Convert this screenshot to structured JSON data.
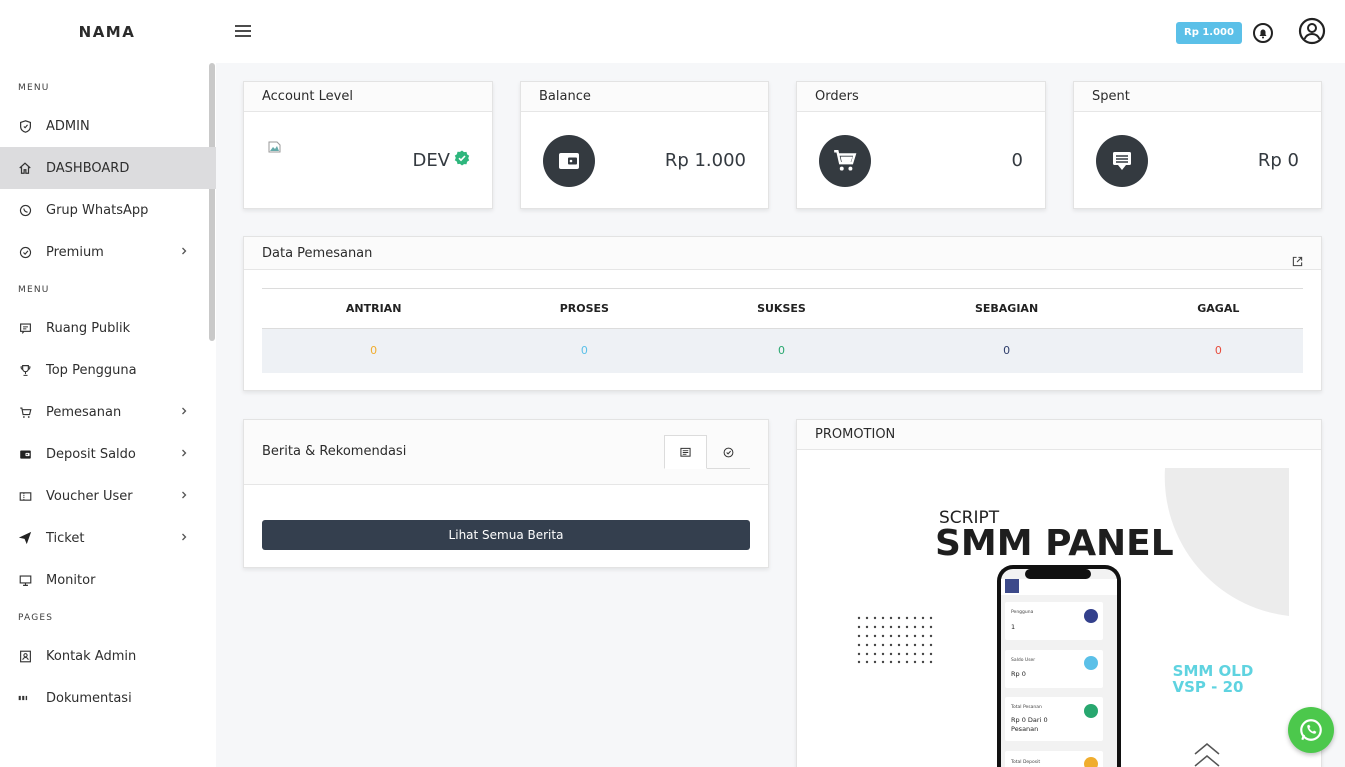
{
  "brand": "NAMA",
  "sidebar": {
    "sections": [
      {
        "title": "MENU",
        "items": [
          {
            "label": "ADMIN",
            "icon": "shield-icon"
          },
          {
            "label": "DASHBOARD",
            "icon": "home-icon",
            "active": true
          },
          {
            "label": "Grup WhatsApp",
            "icon": "whatsapp-icon"
          },
          {
            "label": "Premium",
            "icon": "check-circle-icon",
            "chevron": true
          }
        ]
      },
      {
        "title": "MENU",
        "items": [
          {
            "label": "Ruang Publik",
            "icon": "chat-icon"
          },
          {
            "label": "Top Pengguna",
            "icon": "trophy-icon"
          },
          {
            "label": "Pemesanan",
            "icon": "cart-icon",
            "chevron": true
          },
          {
            "label": "Deposit Saldo",
            "icon": "wallet-icon",
            "chevron": true
          },
          {
            "label": "Voucher User",
            "icon": "ticket-icon",
            "chevron": true
          },
          {
            "label": "Ticket",
            "icon": "send-icon",
            "chevron": true
          },
          {
            "label": "Monitor",
            "icon": "monitor-icon"
          }
        ]
      },
      {
        "title": "PAGES",
        "items": [
          {
            "label": "Kontak Admin",
            "icon": "contact-icon"
          },
          {
            "label": "Dokumentasi",
            "icon": "api-icon"
          }
        ]
      }
    ]
  },
  "topbar": {
    "balance_badge": "Rp 1.000"
  },
  "stats": {
    "account_level": {
      "title": "Account Level",
      "value": "DEV"
    },
    "balance": {
      "title": "Balance",
      "value": "Rp 1.000"
    },
    "orders": {
      "title": "Orders",
      "value": "0"
    },
    "spent": {
      "title": "Spent",
      "value": "Rp 0"
    }
  },
  "orders_panel": {
    "title": "Data Pemesanan",
    "columns": [
      "ANTRIAN",
      "PROSES",
      "SUKSES",
      "SEBAGIAN",
      "GAGAL"
    ],
    "values": [
      "0",
      "0",
      "0",
      "0",
      "0"
    ],
    "value_colors": [
      "#f0ad2e",
      "#5bc0e8",
      "#28a76f",
      "#2f3e6b",
      "#e74c3c"
    ]
  },
  "news": {
    "title": "Berita & Rekomendasi",
    "button": "Lihat Semua Berita"
  },
  "promotion": {
    "title": "PROMOTION",
    "script_label": "SCRIPT",
    "headline": "SMM PANEL",
    "tagline_1": "SMM OLD",
    "tagline_2": "VSP - 20",
    "phone": {
      "card1_label": "Pengguna",
      "card1_value": "1",
      "card2_label": "Saldo User",
      "card2_value": "Rp 0",
      "card3_label": "Total Pesanan",
      "card3_value_1": "Rp 0 Dari 0",
      "card3_value_2": "Pesanan",
      "card4_label": "Total Deposit"
    }
  },
  "colors": {
    "accent": "#5bc0e8",
    "dark": "#343a40",
    "verified": "#2eb67d",
    "whatsapp": "#4cc84c"
  }
}
